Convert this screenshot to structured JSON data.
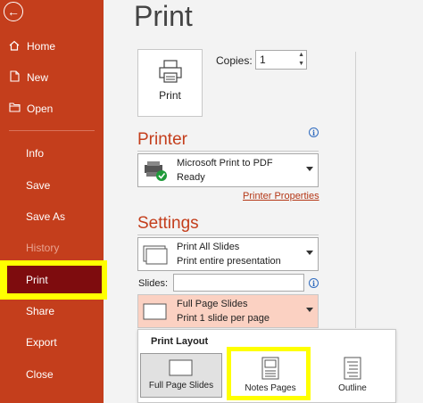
{
  "sidebar": {
    "items": [
      {
        "label": "Home",
        "icon": "home-icon"
      },
      {
        "label": "New",
        "icon": "new-file-icon"
      },
      {
        "label": "Open",
        "icon": "open-folder-icon"
      },
      {
        "label": "Info"
      },
      {
        "label": "Save"
      },
      {
        "label": "Save As"
      },
      {
        "label": "History"
      },
      {
        "label": "Print"
      },
      {
        "label": "Share"
      },
      {
        "label": "Export"
      },
      {
        "label": "Close"
      }
    ],
    "bg_color": "#c43e1c",
    "selected_color": "#7e0c0e",
    "highlight_color": "#ffff00"
  },
  "main": {
    "title": "Print",
    "print_button_label": "Print",
    "copies_label": "Copies:",
    "copies_value": "1",
    "printer_section": "Printer",
    "printer_name": "Microsoft Print to PDF",
    "printer_status": "Ready",
    "printer_properties": "Printer Properties",
    "settings_section": "Settings",
    "slides_option_title": "Print All Slides",
    "slides_option_sub": "Print entire presentation",
    "slides_label": "Slides:",
    "slides_value": "",
    "layout_option_title": "Full Page Slides",
    "layout_option_sub": "Print 1 slide per page"
  },
  "popup": {
    "title": "Print Layout",
    "options": [
      {
        "label": "Full Page Slides"
      },
      {
        "label": "Notes Pages"
      },
      {
        "label": "Outline"
      }
    ]
  }
}
